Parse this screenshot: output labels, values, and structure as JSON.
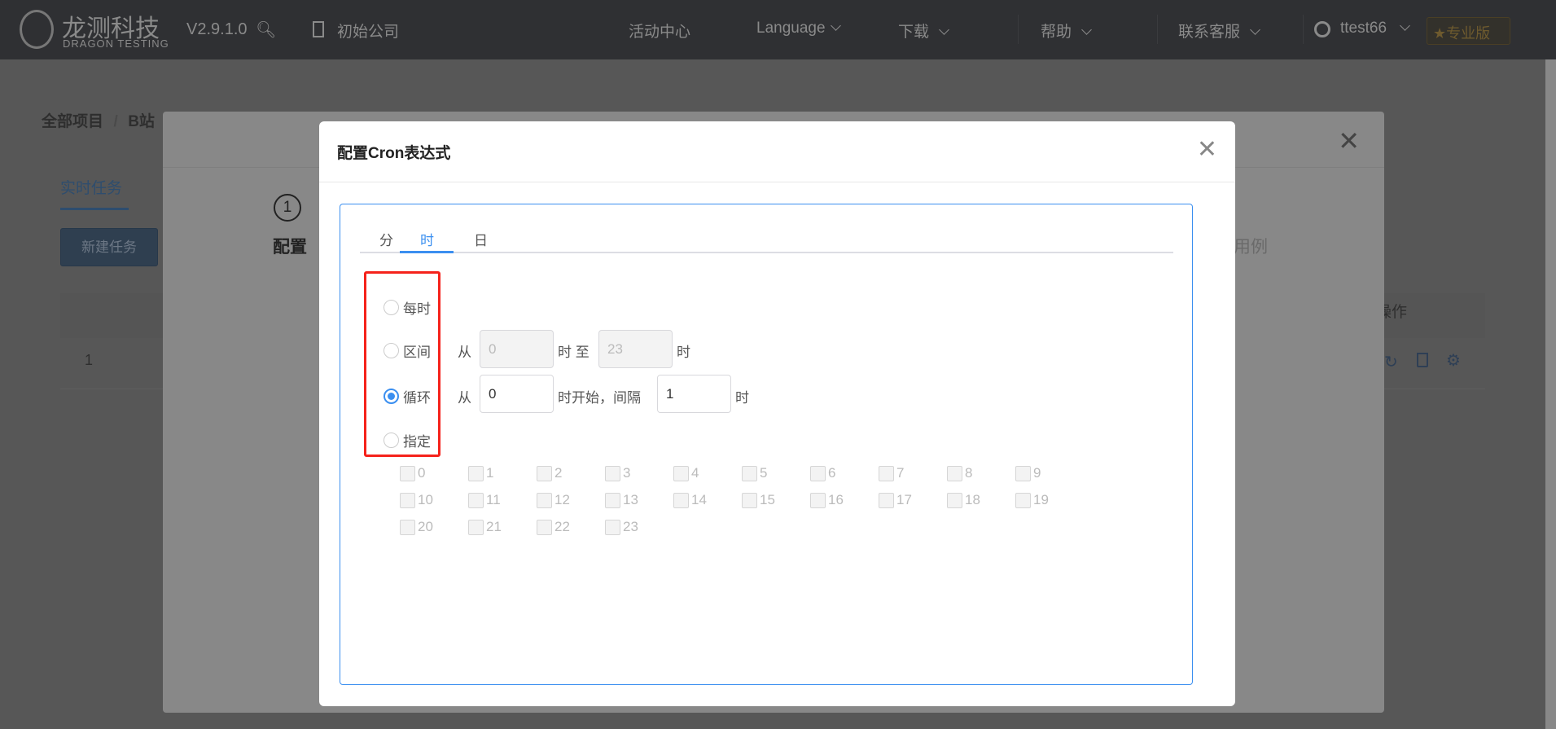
{
  "topbar": {
    "logo_cn": "龙测科技",
    "logo_en": "DRAGON TESTING",
    "version": "V2.9.1.0",
    "company": "初始公司",
    "activity": "活动中心",
    "language": "Language",
    "download": "下载",
    "help": "帮助",
    "support": "联系客服",
    "user": "ttest66",
    "pro_badge": "专业版"
  },
  "page": {
    "breadcrumb_root": "全部项目",
    "breadcrumb_sep": "/",
    "breadcrumb_current": "B站",
    "tab": "实时任务",
    "new_task_button": "新建任务",
    "row_index": "1",
    "ops_header": "操作"
  },
  "bg_modal": {
    "step_number": "1",
    "step_label": "配置",
    "step_label_right": "用例"
  },
  "dialog": {
    "title": "配置Cron表达式",
    "tabs": [
      {
        "label": "分"
      },
      {
        "label": "时"
      },
      {
        "label": "日"
      }
    ],
    "active_tab": "时",
    "options": [
      {
        "label": "每时",
        "selected": false
      },
      {
        "label": "区间",
        "selected": false
      },
      {
        "label": "循环",
        "selected": true
      },
      {
        "label": "指定",
        "selected": false
      }
    ],
    "range": {
      "from_label": "从",
      "from_value": "0",
      "mid_label": "时 至",
      "to_value": "23",
      "end_label": "时"
    },
    "cycle": {
      "from_label": "从",
      "start_value": "0",
      "mid_label": "时开始，间隔",
      "interval_value": "1",
      "end_label": "时"
    },
    "hours": [
      "0",
      "1",
      "2",
      "3",
      "4",
      "5",
      "6",
      "7",
      "8",
      "9",
      "10",
      "11",
      "12",
      "13",
      "14",
      "15",
      "16",
      "17",
      "18",
      "19",
      "20",
      "21",
      "22",
      "23"
    ]
  },
  "colors": {
    "accent": "#3b8ff0",
    "highlight": "#f5221b"
  }
}
